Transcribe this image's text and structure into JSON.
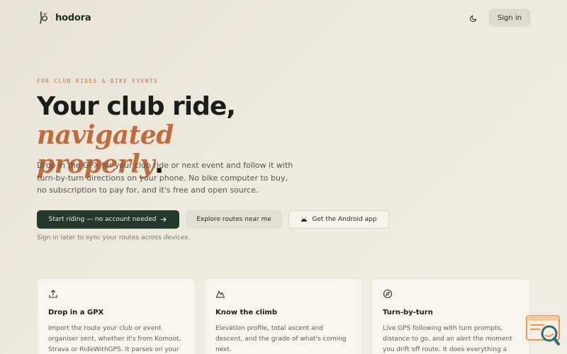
{
  "header": {
    "brand_name": "hodora",
    "signin_label": "Sign in"
  },
  "hero": {
    "eyebrow": "FOR CLUB RIDES & BIKE EVENTS",
    "headline_plain": "Your club ride, ",
    "headline_accent_1": "navigated",
    "headline_accent_2": "properly",
    "headline_end": ".",
    "lede": "Drop in the GPX for your club ride or next event and follow it with turn-by-turn directions on your phone. No bike computer to buy, no subscription to pay for, and it's free and open source.",
    "primary_cta": "Start riding — no account needed",
    "secondary_cta": "Explore routes near me",
    "android_cta": "Get the Android app",
    "signin_note": "Sign in later to sync your routes across devices."
  },
  "features": [
    {
      "icon": "upload-icon",
      "title": "Drop in a GPX",
      "body": "Import the route your club or event organiser sent, whether it's from Komoot, Strava or RideWithGPS. It parses on your phone in a second."
    },
    {
      "icon": "mountain-icon",
      "title": "Know the climb",
      "body": "Elevation profile, total ascent and descent, and the grade of what's coming next."
    },
    {
      "icon": "compass-icon",
      "title": "Turn-by-turn",
      "body": "Live GPS following with turn prompts, distance to go, and an alert the moment you drift off route. It does everything a bike computer does, for free."
    }
  ],
  "colors": {
    "accent": "#c06b3f",
    "primary_button": "#22392b",
    "background": "#ece8dc"
  }
}
